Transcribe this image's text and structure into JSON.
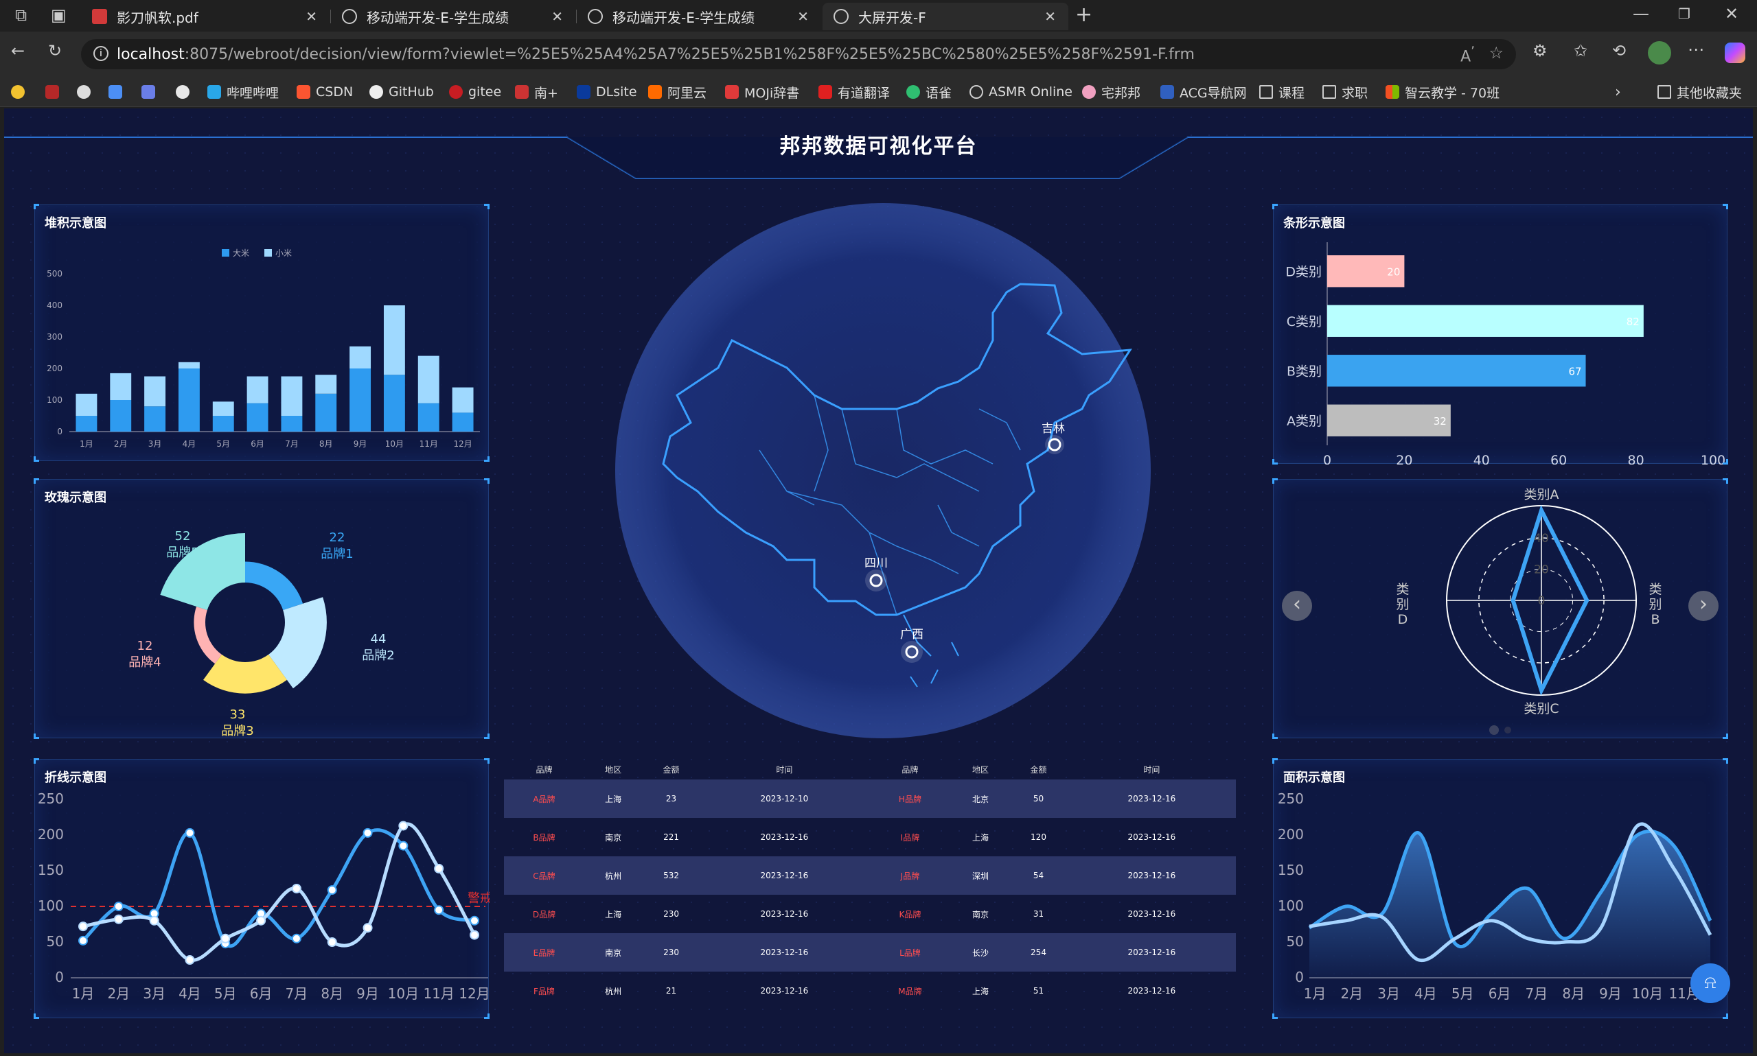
{
  "browser": {
    "tabs": [
      {
        "title": "影刀帆软.pdf",
        "icon": "pdf-icon"
      },
      {
        "title": "移动端开发-E-学生成绩",
        "icon": "globe-icon"
      },
      {
        "title": "移动端开发-E-学生成绩",
        "icon": "globe-icon"
      },
      {
        "title": "大屏开发-F",
        "icon": "globe-icon"
      }
    ],
    "url_host": "localhost",
    "url_rest": ":8075/webroot/decision/view/form?viewlet=%25E5%25A4%25A7%25E5%25B1%258F%25E5%25BC%2580%25E5%258F%2591-F.frm",
    "bookmarks": [
      "哔哩哔哩",
      "CSDN",
      "GitHub",
      "gitee",
      "南+",
      "DLsite",
      "阿里云",
      "MOJi辞書",
      "有道翻译",
      "语雀",
      "ASMR Online",
      "宅邦邦",
      "ACG导航网",
      "课程",
      "求职",
      "智云教学 - 70班"
    ],
    "other_bookmarks": "其他收藏夹"
  },
  "dashboard": {
    "title": "邦邦数据可视化平台",
    "panels": {
      "stacked": "堆积示意图",
      "rose": "玫瑰示意图",
      "line": "折线示意图",
      "bar": "条形示意图",
      "area": "面积示意图"
    }
  },
  "chart_data": [
    {
      "type": "bar",
      "title": "堆积示意图",
      "categories": [
        "1月",
        "2月",
        "3月",
        "4月",
        "5月",
        "6月",
        "7月",
        "8月",
        "9月",
        "10月",
        "11月",
        "12月"
      ],
      "series": [
        {
          "name": "大米",
          "values": [
            50,
            100,
            80,
            200,
            50,
            90,
            50,
            120,
            200,
            180,
            90,
            60
          ]
        },
        {
          "name": "小米",
          "values": [
            70,
            85,
            95,
            20,
            45,
            85,
            125,
            60,
            70,
            220,
            150,
            80
          ]
        }
      ],
      "ylim": [
        0,
        500
      ],
      "yticks": [
        0,
        100,
        200,
        300,
        400,
        500
      ],
      "colors": [
        "#2e9bf0",
        "#9fd9ff"
      ]
    },
    {
      "type": "pie",
      "title": "玫瑰示意图",
      "labels": [
        "品牌1",
        "品牌2",
        "品牌3",
        "品牌4",
        "品牌5"
      ],
      "values": [
        22,
        44,
        33,
        12,
        52
      ],
      "colors": [
        "#39a7f5",
        "#bfeaff",
        "#ffe56a",
        "#ffb3b3",
        "#8ee6e6"
      ]
    },
    {
      "type": "line",
      "title": "折线示意图",
      "categories": [
        "1月",
        "2月",
        "3月",
        "4月",
        "5月",
        "6月",
        "7月",
        "8月",
        "9月",
        "10月",
        "11月",
        "12月"
      ],
      "series": [
        {
          "values": [
            52,
            100,
            90,
            203,
            48,
            90,
            55,
            123,
            203,
            185,
            95,
            80
          ]
        },
        {
          "values": [
            72,
            82,
            80,
            25,
            55,
            80,
            125,
            50,
            70,
            213,
            153,
            60
          ]
        }
      ],
      "ylim": [
        0,
        250
      ],
      "yticks": [
        0,
        50,
        100,
        150,
        200,
        250
      ],
      "markline": {
        "value": 100,
        "label": "警戒线"
      }
    },
    {
      "type": "bar",
      "title": "条形示意图",
      "orientation": "horizontal",
      "categories": [
        "D类别",
        "C类别",
        "B类别",
        "A类别"
      ],
      "values": [
        20,
        82,
        67,
        32
      ],
      "colors": [
        "#ffb9b9",
        "#b8ffff",
        "#3aa3f0",
        "#bdbdbd"
      ],
      "xlim": [
        0,
        100
      ],
      "xticks": [
        0,
        20,
        40,
        60,
        80,
        100
      ]
    },
    {
      "type": "radar",
      "indicators": [
        "类别A",
        "类别B",
        "类别C",
        "类别D"
      ],
      "ticks": [
        0,
        20,
        40
      ]
    },
    {
      "type": "area",
      "title": "面积示意图",
      "categories": [
        "1月",
        "2月",
        "3月",
        "4月",
        "5月",
        "6月",
        "7月",
        "8月",
        "9月",
        "10月",
        "11月"
      ],
      "series": [
        {
          "values": [
            70,
            100,
            90,
            203,
            48,
            90,
            125,
            55,
            120,
            200,
            185,
            80
          ]
        },
        {
          "values": [
            72,
            80,
            85,
            25,
            55,
            80,
            55,
            50,
            70,
            213,
            153,
            60
          ]
        }
      ],
      "ylim": [
        0,
        250
      ],
      "yticks": [
        0,
        50,
        100,
        150,
        200,
        250
      ]
    },
    {
      "type": "table",
      "headers": [
        "品牌",
        "地区",
        "金额",
        "时间",
        "品牌",
        "地区",
        "金额",
        "时间"
      ],
      "rows": [
        [
          "A品牌",
          "上海",
          "23",
          "2023-12-10",
          "H品牌",
          "北京",
          "50",
          "2023-12-16"
        ],
        [
          "B品牌",
          "南京",
          "221",
          "2023-12-16",
          "I品牌",
          "上海",
          "120",
          "2023-12-16"
        ],
        [
          "C品牌",
          "杭州",
          "532",
          "2023-12-16",
          "J品牌",
          "深圳",
          "54",
          "2023-12-16"
        ],
        [
          "D品牌",
          "上海",
          "230",
          "2023-12-16",
          "K品牌",
          "南京",
          "31",
          "2023-12-16"
        ],
        [
          "E品牌",
          "南京",
          "230",
          "2023-12-16",
          "L品牌",
          "长沙",
          "254",
          "2023-12-16"
        ],
        [
          "F品牌",
          "杭州",
          "21",
          "2023-12-16",
          "M品牌",
          "上海",
          "51",
          "2023-12-16"
        ]
      ]
    }
  ],
  "map": {
    "points": [
      "吉林",
      "四川",
      "广西"
    ]
  }
}
